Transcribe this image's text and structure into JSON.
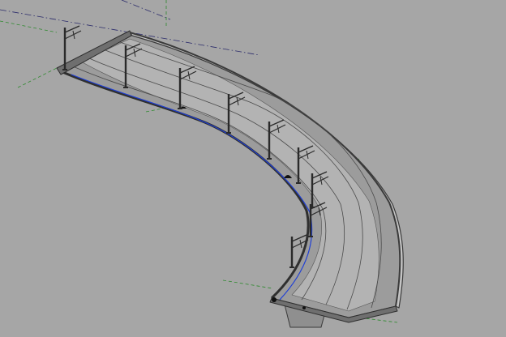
{
  "viewport": {
    "background": "#a6a6a6",
    "view_type": "3d-isometric",
    "model": "curved-bridge-with-catenary-masts",
    "render_style": "shaded-with-edges"
  },
  "colors": {
    "deck_fill": "#9c9c9c",
    "deck_inner": "#b3b3b3",
    "parapet_fill": "#c4c4c4",
    "edge": "#3a3a3a",
    "mast": "#2a2a2a",
    "grid_green": "#2e8a2e",
    "section_dashdot": "#2b2b6b",
    "alignment_blue": "#1f3fd6",
    "girder": "#8f8f8f"
  },
  "masts": {
    "count": 9
  }
}
